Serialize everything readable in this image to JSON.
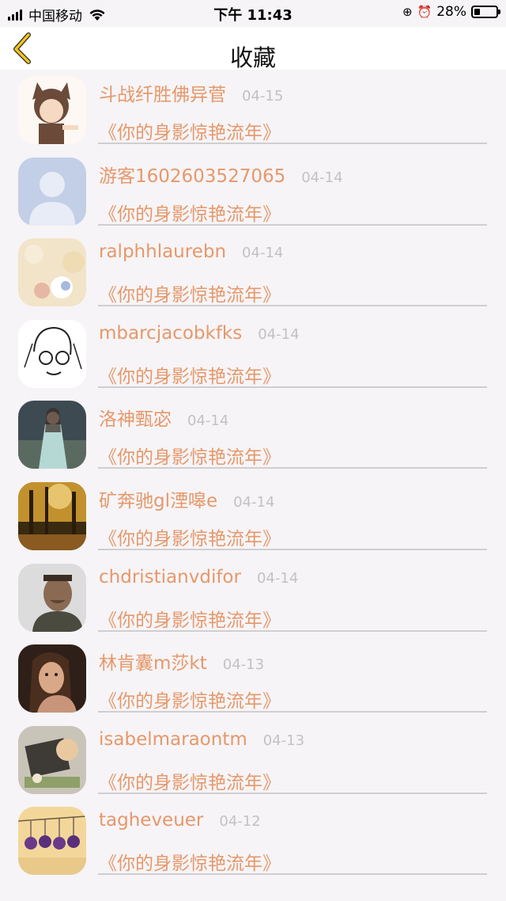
{
  "status_bar": {
    "carrier": "中国移动",
    "time": "下午 11:43",
    "battery_percent": "28%",
    "battery_level": 0.28,
    "icons": [
      "signal-icon",
      "wifi-icon",
      "orientation-lock-icon",
      "alarm-icon",
      "battery-icon"
    ]
  },
  "nav": {
    "back_icon": "chevron-left-icon",
    "title": "收藏",
    "accent": "#f0c419"
  },
  "colors": {
    "accent_text": "#e6986a",
    "date_text": "#c2c2c2",
    "background": "#f6f4f7"
  },
  "favorites": [
    {
      "name": "斗战纤胜佛异菅",
      "date": "04-15",
      "title": "《你的身影惊艳流年》"
    },
    {
      "name": "游客1602603527065",
      "date": "04-14",
      "title": "《你的身影惊艳流年》"
    },
    {
      "name": "ralphhlaurebn",
      "date": "04-14",
      "title": "《你的身影惊艳流年》"
    },
    {
      "name": "mbarcjacobkfks",
      "date": "04-14",
      "title": "《你的身影惊艳流年》"
    },
    {
      "name": "洛神甄宓",
      "date": "04-14",
      "title": "《你的身影惊艳流年》"
    },
    {
      "name": "矿奔驰gl湮嗥e",
      "date": "04-14",
      "title": "《你的身影惊艳流年》"
    },
    {
      "name": "chdristianvdifor",
      "date": "04-14",
      "title": "《你的身影惊艳流年》"
    },
    {
      "name": "林肯囊m莎kt",
      "date": "04-13",
      "title": "《你的身影惊艳流年》"
    },
    {
      "name": "isabelmaraontm",
      "date": "04-13",
      "title": "《你的身影惊艳流年》"
    },
    {
      "name": "tagheveuer",
      "date": "04-12",
      "title": "《你的身影惊艳流年》"
    }
  ]
}
